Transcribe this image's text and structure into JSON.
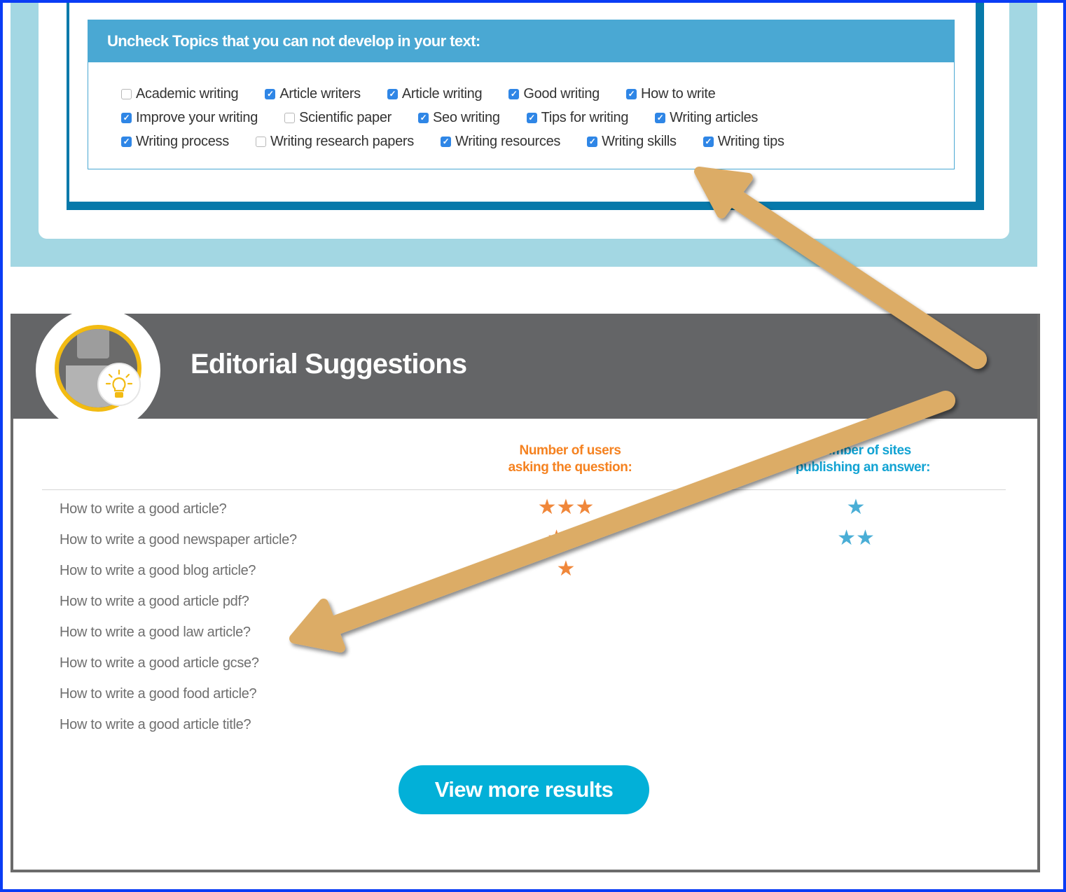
{
  "topics": {
    "header": "Uncheck Topics that you can not develop in your text:",
    "rows": [
      [
        {
          "label": "Academic writing",
          "checked": false
        },
        {
          "label": "Article writers",
          "checked": true
        },
        {
          "label": "Article writing",
          "checked": true
        },
        {
          "label": "Good writing",
          "checked": true
        },
        {
          "label": "How to write",
          "checked": true
        }
      ],
      [
        {
          "label": "Improve your writing",
          "checked": true
        },
        {
          "label": "Scientific paper",
          "checked": false
        },
        {
          "label": "Seo writing",
          "checked": true
        },
        {
          "label": "Tips for writing",
          "checked": true
        },
        {
          "label": "Writing articles",
          "checked": true
        }
      ],
      [
        {
          "label": "Writing process",
          "checked": true
        },
        {
          "label": "Writing research papers",
          "checked": false
        },
        {
          "label": "Writing resources",
          "checked": true
        },
        {
          "label": "Writing skills",
          "checked": true
        },
        {
          "label": "Writing tips",
          "checked": true
        }
      ]
    ]
  },
  "editorial": {
    "title": "Editorial Suggestions",
    "avatar_icon": "robot-lightbulb-icon",
    "columns": {
      "users_line1": "Number of users",
      "users_line2": "asking the question:",
      "sites_line1": "Number of sites",
      "sites_line2": "publishing an answer:"
    },
    "questions": [
      {
        "text": "How to write a good article?",
        "users_stars": 3,
        "sites_stars": 1
      },
      {
        "text": "How to write a good newspaper article?",
        "users_stars": 2,
        "sites_stars": 2
      },
      {
        "text": "How to write a good blog article?",
        "users_stars": 1,
        "sites_stars": 0
      },
      {
        "text": "How to write a good article pdf?",
        "users_stars": 0,
        "sites_stars": 0
      },
      {
        "text": "How to write a good law article?",
        "users_stars": 0,
        "sites_stars": 0
      },
      {
        "text": "How to write a good article gcse?",
        "users_stars": 0,
        "sites_stars": 0
      },
      {
        "text": "How to write a good food article?",
        "users_stars": 0,
        "sites_stars": 0
      },
      {
        "text": "How to write a good article title?",
        "users_stars": 0,
        "sites_stars": 0
      }
    ],
    "view_more_label": "View more results"
  },
  "colors": {
    "frame": "#0a3cf5",
    "light_band": "#a3d7e3",
    "inner_border": "#0779aa",
    "topics_header": "#4aa8d3",
    "checkbox": "#2f86e6",
    "editorial_header": "#646567",
    "users_accent": "#f58220",
    "sites_accent": "#12a3d3",
    "button": "#02b0d8",
    "arrow": "#dcac66"
  },
  "annotations": {
    "arrows": [
      "arrow-pointing-to-topics-panel",
      "arrow-pointing-to-questions-list"
    ]
  }
}
